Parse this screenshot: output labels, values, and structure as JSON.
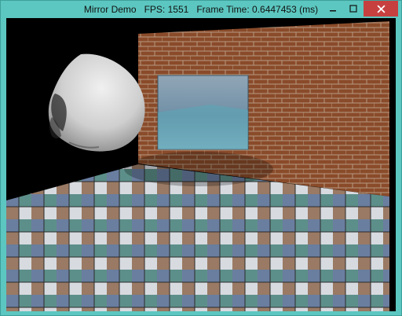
{
  "window": {
    "title_app": "Mirror Demo",
    "title_fps_label": "FPS:",
    "title_fps_value": "1551",
    "title_frame_label": "Frame Time:",
    "title_frame_value": "0.6447453",
    "title_frame_unit": "(ms)"
  },
  "controls": {
    "minimize_icon": "minimize-icon",
    "maximize_icon": "maximize-icon",
    "close_icon": "close-icon"
  },
  "colors": {
    "titlebar": "#5cc7c0",
    "close_button": "#c74040",
    "viewport_bg": "#000000",
    "brick": "#8a4b2a",
    "mortar": "#b59a82",
    "skull": "#cfcfcf",
    "mirror": "#6f8fa6"
  },
  "scene": {
    "objects": [
      "skull",
      "brick-wall",
      "mirror",
      "checkered-floor"
    ]
  }
}
